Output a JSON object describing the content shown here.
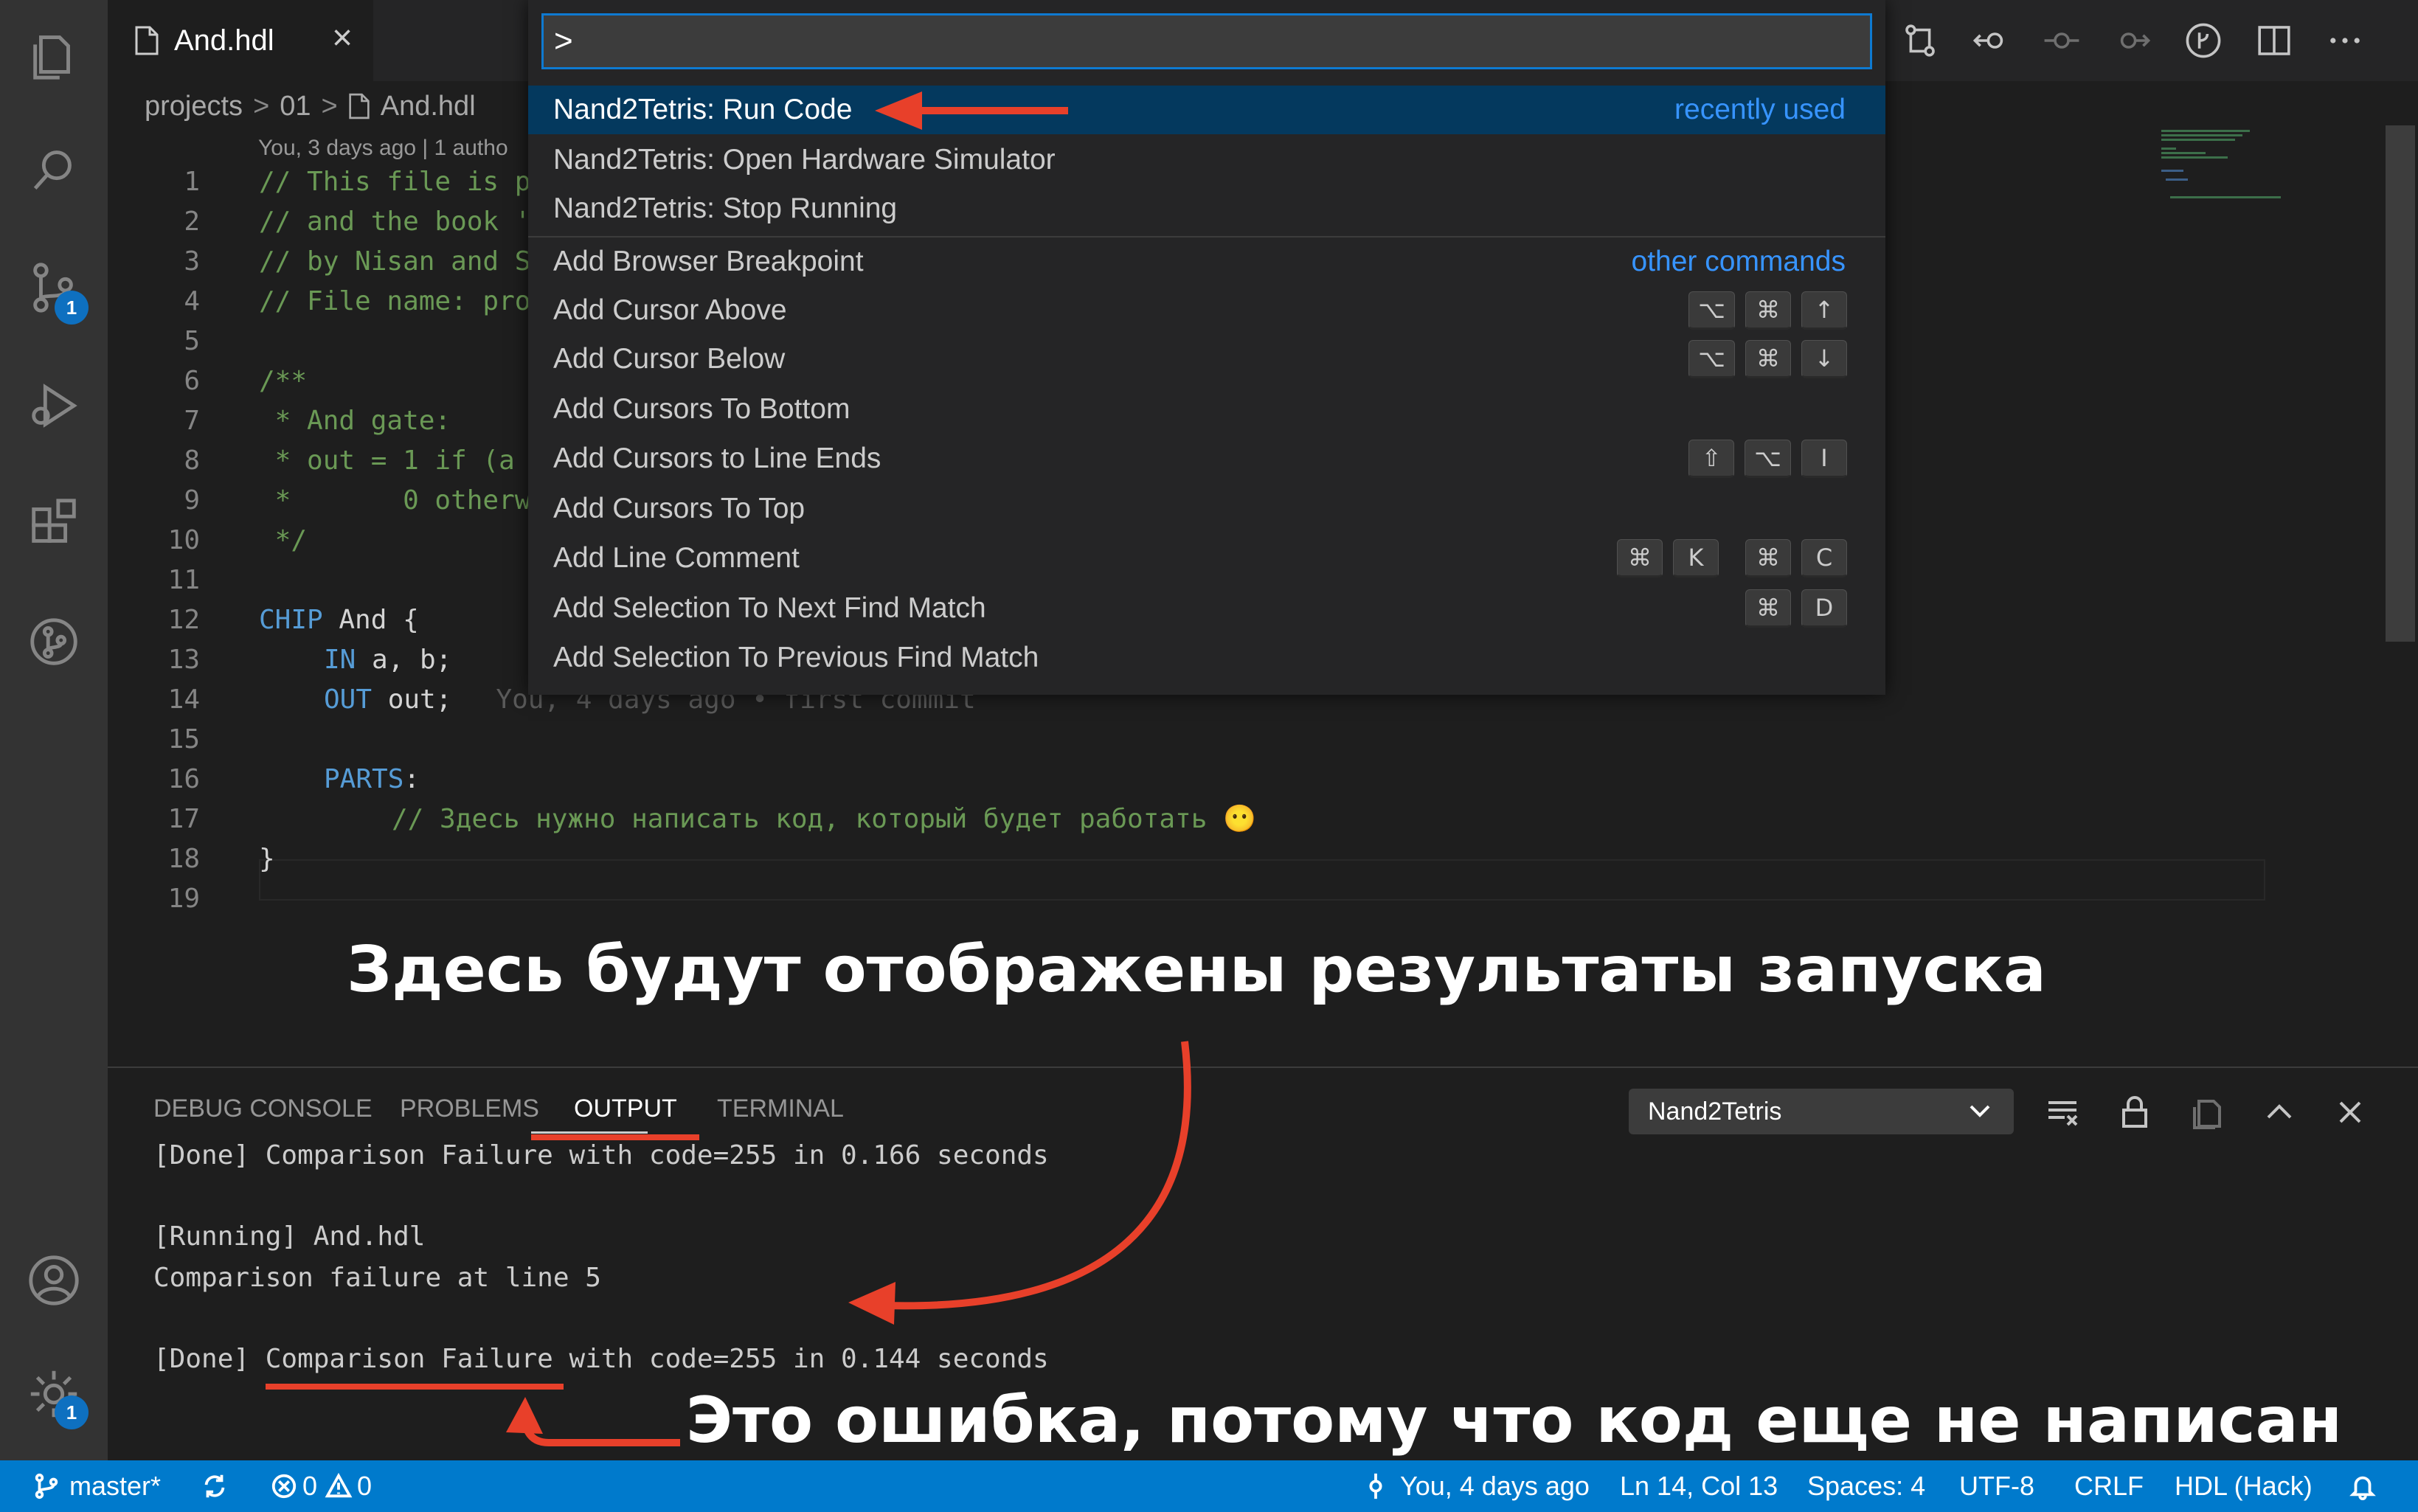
{
  "tab": {
    "title": "And.hdl",
    "close": "×"
  },
  "breadcrumb": {
    "parts": [
      "projects",
      "01",
      "And.hdl"
    ],
    "sep": ">"
  },
  "codelens": "You, 3 days ago | 1 autho",
  "editor": {
    "lines": [
      {
        "n": "1",
        "text": "// This file is p"
      },
      {
        "n": "2",
        "text": "// and the book '"
      },
      {
        "n": "3",
        "text": "// by Nisan and S"
      },
      {
        "n": "4",
        "text": "// File name: pro"
      },
      {
        "n": "5",
        "text": ""
      },
      {
        "n": "6",
        "text": "/**"
      },
      {
        "n": "7",
        "text": " * And gate:"
      },
      {
        "n": "8",
        "text": " * out = 1 if (a"
      },
      {
        "n": "9",
        "text": " *       0 otherw"
      },
      {
        "n": "10",
        "text": " */"
      },
      {
        "n": "11",
        "text": ""
      },
      {
        "n": "12",
        "kw": "CHIP",
        "rest": " And {"
      },
      {
        "n": "13",
        "kw": "IN",
        "rest": " a, b;"
      },
      {
        "n": "14",
        "kw": "OUT",
        "rest": " out;"
      },
      {
        "n": "15",
        "text": ""
      },
      {
        "n": "16",
        "kw": "PARTS",
        "rest": ":"
      },
      {
        "n": "17",
        "text": "// Здесь нужно написать код, который будет работать 😶"
      },
      {
        "n": "18",
        "text": "}"
      },
      {
        "n": "19",
        "text": ""
      }
    ],
    "blame": "You, 4 days ago • first commit"
  },
  "palette": {
    "input": ">",
    "items": [
      {
        "label": "Nand2Tetris: Run Code",
        "tag": "recently used"
      },
      {
        "label": "Nand2Tetris: Open Hardware Simulator"
      },
      {
        "label": "Nand2Tetris: Stop Running"
      },
      {
        "label": "Add Browser Breakpoint",
        "tag": "other commands"
      },
      {
        "label": "Add Cursor Above",
        "keys": [
          "⌥",
          "⌘",
          "↑"
        ]
      },
      {
        "label": "Add Cursor Below",
        "keys": [
          "⌥",
          "⌘",
          "↓"
        ]
      },
      {
        "label": "Add Cursors To Bottom"
      },
      {
        "label": "Add Cursors to Line Ends",
        "keys": [
          "⇧",
          "⌥",
          "I"
        ]
      },
      {
        "label": "Add Cursors To Top"
      },
      {
        "label": "Add Line Comment",
        "keys": [
          "⌘",
          "K",
          "⌘",
          "C"
        ]
      },
      {
        "label": "Add Selection To Next Find Match",
        "keys": [
          "⌘",
          "D"
        ]
      },
      {
        "label": "Add Selection To Previous Find Match"
      }
    ]
  },
  "annotations": {
    "results": "Здесь будут отображены результаты запуска",
    "error": "Это ошибка, потому что код еще не написан"
  },
  "panel": {
    "tabs": [
      "DEBUG CONSOLE",
      "PROBLEMS",
      "OUTPUT",
      "TERMINAL"
    ],
    "channel": "Nand2Tetris",
    "output": [
      "[Done] Comparison Failure with code=255 in 0.166 seconds",
      "",
      "[Running] And.hdl",
      "Comparison failure at line 5",
      "",
      "[Done] Comparison Failure with code=255 in 0.144 seconds"
    ]
  },
  "statusbar": {
    "branch": "master*",
    "errors": "0",
    "warnings": "0",
    "blame": "You, 4 days ago",
    "position": "Ln 14, Col 13",
    "spaces": "Spaces: 4",
    "encoding": "UTF-8",
    "eol": "CRLF",
    "language": "HDL (Hack)"
  },
  "badges": {
    "scm": "1",
    "settings": "1"
  },
  "colors": {
    "accent": "#007acc",
    "arrow": "#e8402a",
    "selection": "#04395e",
    "link": "#3794ff"
  }
}
